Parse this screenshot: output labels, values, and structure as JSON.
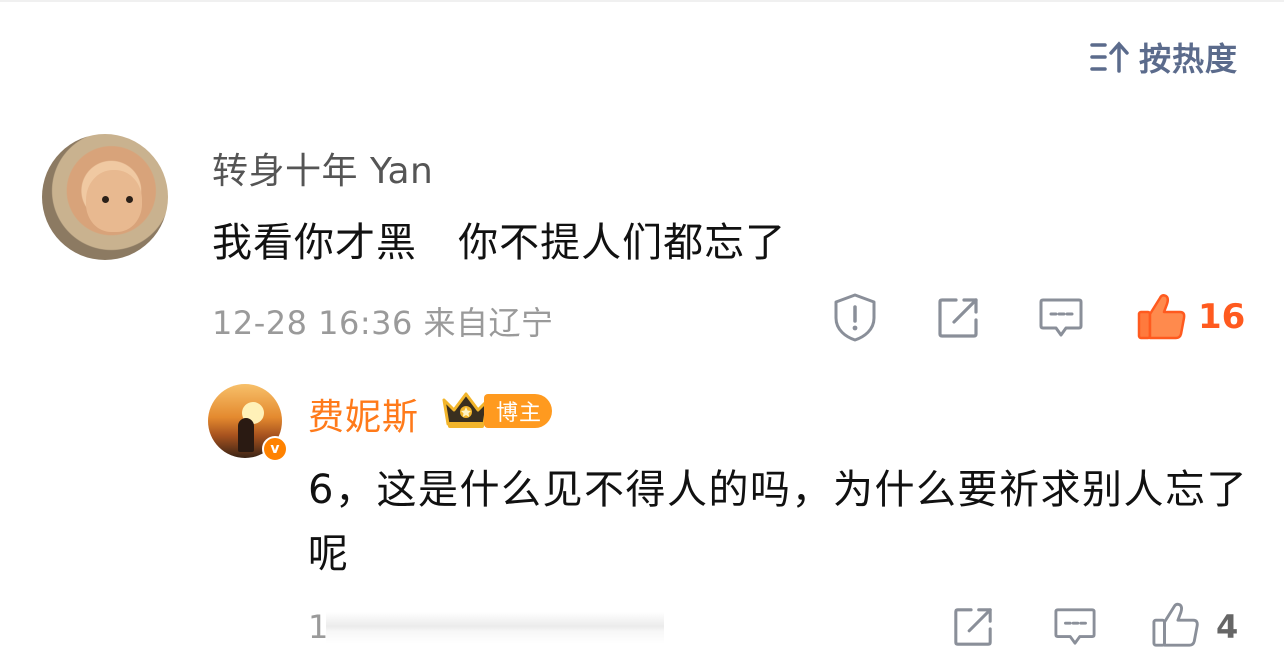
{
  "sort": {
    "label": "按热度",
    "icon": "sort-icon"
  },
  "comment": {
    "username": "转身十年 Yan",
    "text": "我看你才黑   你不提人们都忘了",
    "time": "12-28 16:36",
    "location": "来自辽宁",
    "likes": "16",
    "accent_color": "#ff5a1f"
  },
  "reply": {
    "username": "费妮斯",
    "badge_label": "博主",
    "verified_mark": "v",
    "text": "6，这是什么见不得人的吗，为什么要祈求别人忘了呢",
    "meta_visible": "1",
    "likes": "4",
    "username_color": "#ff7a1a"
  }
}
